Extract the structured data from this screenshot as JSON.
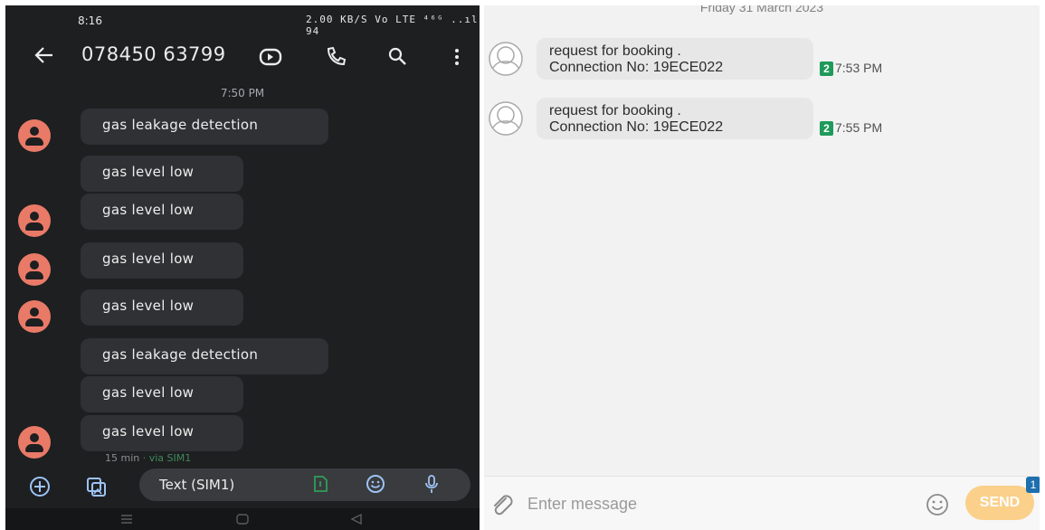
{
  "left_phone": {
    "status": {
      "time": "8:16",
      "indicators": "2.00 KB/S Vo LTE ⁴⁶ᴳ ..ıl 94"
    },
    "header": {
      "phone_number": "078450 63799"
    },
    "date_label": "7:50 PM",
    "messages": [
      {
        "text": "gas leakage detection",
        "avatar": true
      },
      {
        "text": "gas level low",
        "avatar": false
      },
      {
        "text": "gas level low",
        "avatar": true
      },
      {
        "text": "gas level low",
        "avatar": true
      },
      {
        "text": "gas level low",
        "avatar": true
      },
      {
        "text": "gas leakage detection",
        "avatar": false
      },
      {
        "text": "gas level low",
        "avatar": false
      },
      {
        "text": "gas level low",
        "avatar": true
      }
    ],
    "last_meta": {
      "time": "15 min",
      "via": " · via SIM1"
    },
    "composer": {
      "placeholder": "Text (SIM1)"
    },
    "icons": [
      "back-arrow-icon",
      "video-call-icon",
      "phone-icon",
      "search-icon",
      "more-vert-icon",
      "add-circle-icon",
      "gallery-icon",
      "sim-icon",
      "emoji-icon",
      "mic-icon",
      "nav-menu-icon",
      "nav-home-icon",
      "nav-back-icon"
    ],
    "colors": {
      "background": "#1e1f21",
      "bubble": "#303134",
      "avatar": "#e97a67"
    }
  },
  "right_phone": {
    "date_label": "Friday 31 March 2023",
    "messages": [
      {
        "line1": "request for booking .",
        "line2": "Connection No: 19ECE022",
        "sim": "2",
        "time": "7:53 PM"
      },
      {
        "line1": "request for booking .",
        "line2": "Connection No: 19ECE022",
        "sim": "2",
        "time": "7:55 PM"
      }
    ],
    "composer": {
      "placeholder": "Enter message",
      "send_label": "SEND",
      "send_count": "1"
    },
    "icons": [
      "contact-avatar-icon",
      "attach-icon",
      "emoji-icon"
    ],
    "colors": {
      "background": "#f2f2f2",
      "bubble": "#e7e7e7",
      "sim_badge": "#1f9a5a",
      "send_button": "#fbd08a"
    }
  }
}
